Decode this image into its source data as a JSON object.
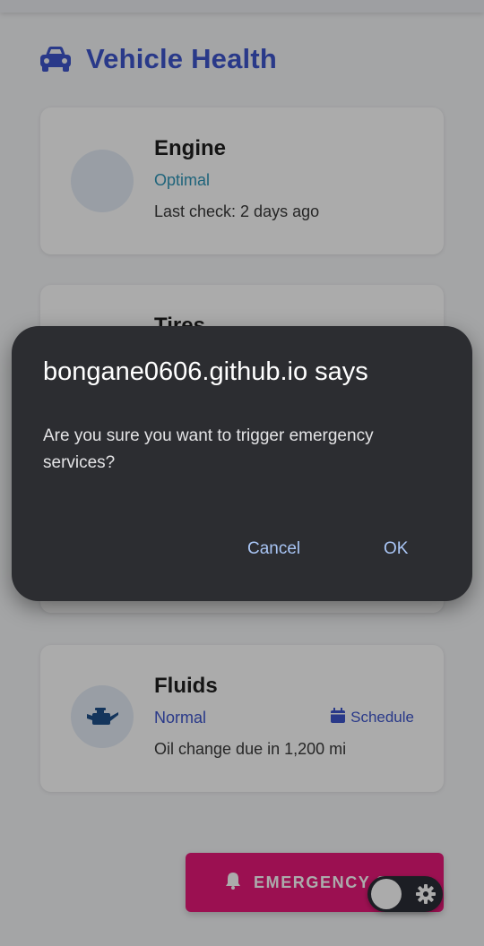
{
  "page": {
    "title": "Vehicle Health"
  },
  "cards": {
    "engine": {
      "title": "Engine",
      "status": "Optimal",
      "detail": "Last check: 2 days ago"
    },
    "tires": {
      "title": "Tires"
    },
    "fluids": {
      "title": "Fluids",
      "status": "Normal",
      "action": "Schedule",
      "detail": "Oil change due in 1,200 mi"
    }
  },
  "emergency_button": {
    "label": "EMERGENCY S"
  },
  "dialog": {
    "title": "bongane0606.github.io says",
    "message": "Are you sure you want to trigger emergency services?",
    "cancel": "Cancel",
    "ok": "OK"
  },
  "icons": {
    "title": "car-icon",
    "engine": "engine-icon",
    "fluids": "oil-can-icon",
    "schedule": "calendar-icon",
    "emergency": "bell-icon",
    "toggle": "gear-icon"
  },
  "colors": {
    "accent": "#3e55cc",
    "optimal": "#2f96b8",
    "emergency": "#e8197a",
    "dialog_bg": "#2c2d31",
    "dialog_button": "#a9c5f5"
  }
}
